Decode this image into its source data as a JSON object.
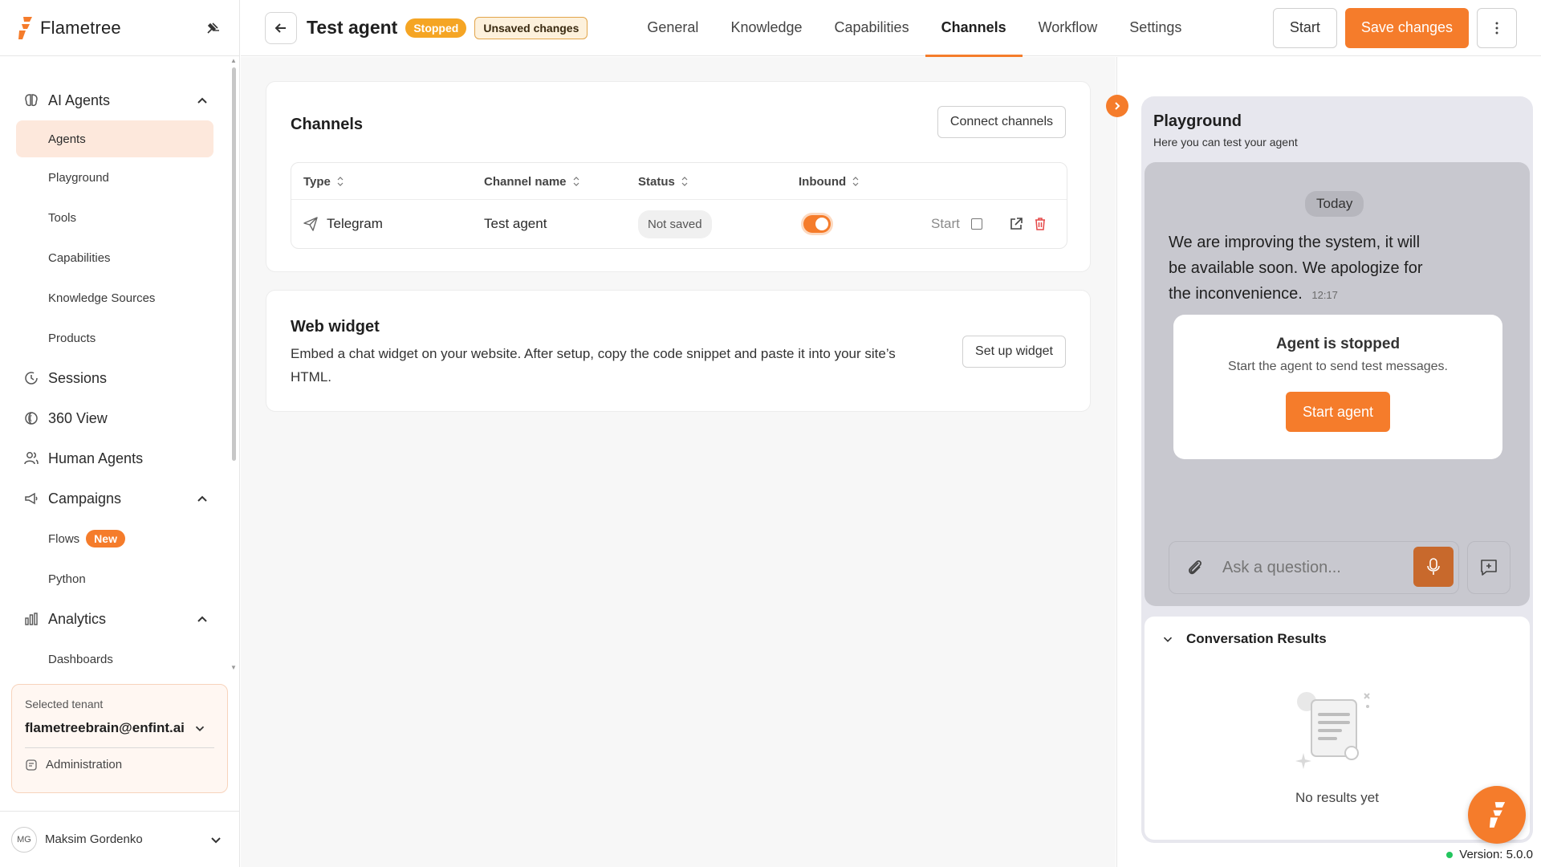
{
  "brand": {
    "name": "Flametree"
  },
  "sidebar": {
    "sections": [
      {
        "label": "AI Agents",
        "icon": "brain-icon",
        "expanded": true,
        "items": [
          {
            "label": "Agents",
            "active": true
          },
          {
            "label": "Playground"
          },
          {
            "label": "Tools"
          },
          {
            "label": "Capabilities"
          },
          {
            "label": "Knowledge Sources"
          },
          {
            "label": "Products"
          }
        ]
      },
      {
        "label": "Sessions",
        "icon": "history-icon"
      },
      {
        "label": "360 View",
        "icon": "spiral-icon"
      },
      {
        "label": "Human Agents",
        "icon": "people-icon"
      },
      {
        "label": "Campaigns",
        "icon": "megaphone-icon",
        "expanded": true,
        "items": [
          {
            "label": "Flows",
            "badge": "New"
          },
          {
            "label": "Python"
          }
        ]
      },
      {
        "label": "Analytics",
        "icon": "bar-chart-icon",
        "expanded": true,
        "items": [
          {
            "label": "Dashboards"
          }
        ]
      }
    ],
    "tenant": {
      "label": "Selected tenant",
      "value": "flametreebrain@enfint.ai",
      "admin": "Administration"
    },
    "user": {
      "initials": "MG",
      "name": "Maksim Gordenko"
    }
  },
  "header": {
    "title": "Test agent",
    "status": "Stopped",
    "unsaved": "Unsaved changes",
    "tabs": [
      "General",
      "Knowledge",
      "Capabilities",
      "Channels",
      "Workflow",
      "Settings"
    ],
    "active_tab": "Channels",
    "start_label": "Start",
    "save_label": "Save changes"
  },
  "channels": {
    "title": "Channels",
    "connect_label": "Connect channels",
    "columns": [
      "Type",
      "Channel name",
      "Status",
      "Inbound"
    ],
    "rows": [
      {
        "type": "Telegram",
        "name": "Test agent",
        "status": "Not saved",
        "inbound": true,
        "start": "Start"
      }
    ]
  },
  "web_widget": {
    "title": "Web widget",
    "description": "Embed a chat widget on your website. After setup, copy the code snippet and paste it into your site’s HTML.",
    "button": "Set up widget"
  },
  "playground": {
    "title": "Playground",
    "subtitle": "Here you can test your agent",
    "date_chip": "Today",
    "message": "We are improving the system, it will be available soon. We apologize for the inconvenience.",
    "message_time": "12:17",
    "stopped_title": "Agent is stopped",
    "stopped_sub": "Start the agent to send test messages.",
    "start_agent": "Start agent",
    "input_placeholder": "Ask a question...",
    "results_title": "Conversation Results",
    "results_empty": "No results yet"
  },
  "version": "Version: 5.0.0",
  "colors": {
    "accent": "#f57c2b",
    "stopped": "#f5a524",
    "online": "#23c55e"
  }
}
